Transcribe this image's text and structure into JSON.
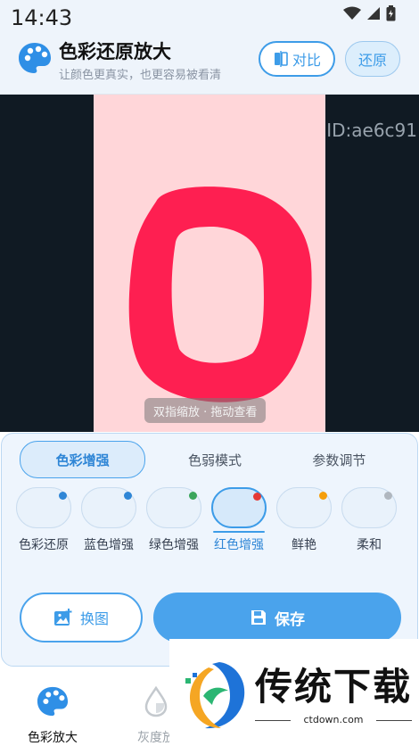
{
  "status": {
    "time": "14:43"
  },
  "header": {
    "title": "色彩还原放大",
    "subtitle": "让颜色更真实，也更容易被看清",
    "compare_label": "对比",
    "restore_label": "还原"
  },
  "canvas": {
    "id_label": "ID:ae6c91",
    "hint": "双指缩放 · 拖动查看",
    "image_bg": "#ffd6d9",
    "shape_color": "#fe1f51"
  },
  "panel": {
    "tabs": [
      {
        "label": "色彩增强",
        "active": true
      },
      {
        "label": "色弱模式",
        "active": false
      },
      {
        "label": "参数调节",
        "active": false
      }
    ],
    "filters": [
      {
        "label": "色彩还原",
        "dot": "#2f86d6"
      },
      {
        "label": "蓝色增强",
        "dot": "#2f86d6"
      },
      {
        "label": "绿色增强",
        "dot": "#3ba55c"
      },
      {
        "label": "红色增强",
        "dot": "#e53935"
      },
      {
        "label": "鲜艳",
        "dot": "#f59e0b"
      },
      {
        "label": "柔和",
        "dot": "#b0b7bf"
      }
    ],
    "swap_label": "换图",
    "save_label": "保存"
  },
  "nav": [
    {
      "label": "色彩放大"
    },
    {
      "label": "灰度放"
    }
  ],
  "watermark": {
    "text": "传统下载",
    "url": "ctdown.com"
  },
  "colors": {
    "accent": "#4aa3ec"
  }
}
